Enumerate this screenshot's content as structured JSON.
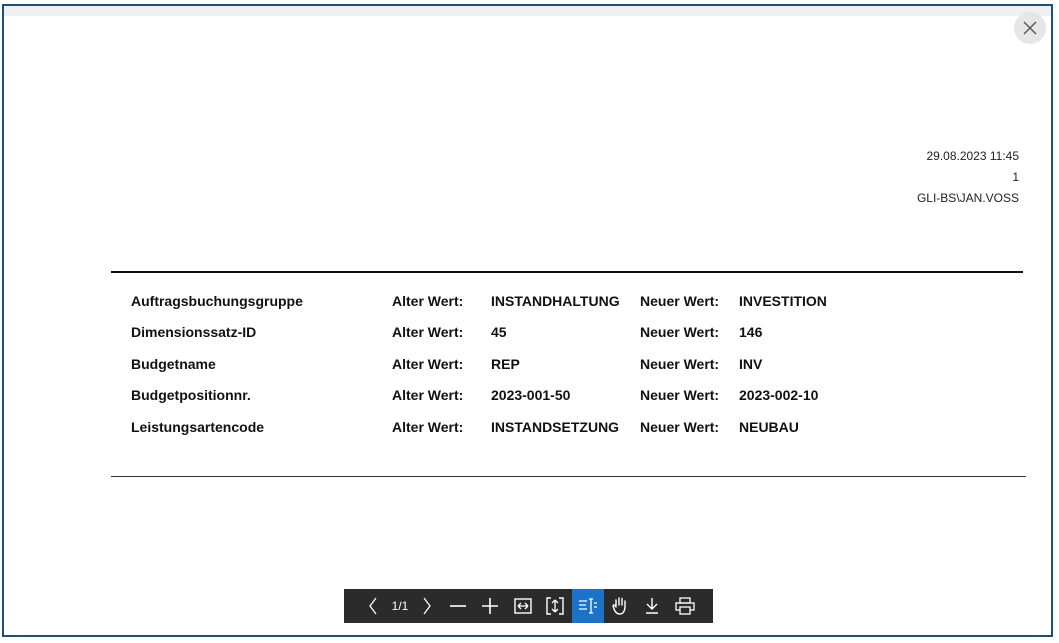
{
  "header": {
    "datetime": "29.08.2023 11:45",
    "page": "1",
    "user": "GLI-BS\\JAN.VOSS"
  },
  "rows": [
    {
      "field": "Auftragsbuchungsgruppe",
      "old_label": "Alter Wert:",
      "old_value": "INSTANDHALTUNG",
      "new_label": "Neuer Wert:",
      "new_value": "INVESTITION"
    },
    {
      "field": "Dimensionssatz-ID",
      "old_label": "Alter Wert:",
      "old_value": "45",
      "new_label": "Neuer Wert:",
      "new_value": "146"
    },
    {
      "field": "Budgetname",
      "old_label": "Alter Wert:",
      "old_value": "REP",
      "new_label": "Neuer Wert:",
      "new_value": "INV"
    },
    {
      "field": "Budgetpositionnr.",
      "old_label": "Alter Wert:",
      "old_value": "2023-001-50",
      "new_label": "Neuer Wert:",
      "new_value": "2023-002-10"
    },
    {
      "field": "Leistungsartencode",
      "old_label": "Alter Wert:",
      "old_value": "INSTANDSETZUNG",
      "new_label": "Neuer Wert:",
      "new_value": "NEUBAU"
    }
  ],
  "toolbar": {
    "page_indicator": "1/1",
    "icons": [
      "chevron-left-icon",
      "chevron-right-icon",
      "zoom-out-icon",
      "zoom-in-icon",
      "fit-width-icon",
      "fit-page-icon",
      "text-select-icon",
      "hand-pan-icon",
      "download-icon",
      "print-icon"
    ],
    "active_tool": "text-select-icon",
    "active_color": "#1a73c9",
    "background_color": "#2b2b2b"
  },
  "accent_border_color": "#1f4e79"
}
